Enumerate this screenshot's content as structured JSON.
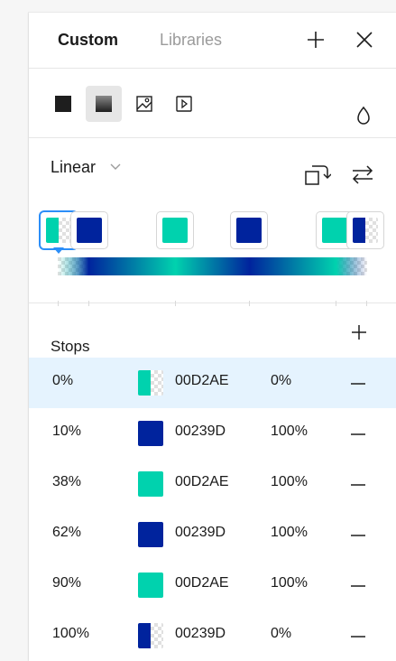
{
  "tabs": {
    "custom": "Custom",
    "libraries": "Libraries"
  },
  "fill_types": [
    "solid",
    "gradient",
    "image",
    "video"
  ],
  "gradient": {
    "type_label": "Linear"
  },
  "stops_section": {
    "title": "Stops"
  },
  "colors": {
    "teal": "#00D2AE",
    "blue": "#00239D",
    "selection": "#e5f3fe",
    "accent": "#2c8ef8"
  },
  "stops": [
    {
      "position": "0%",
      "hex": "00D2AE",
      "opacity": "0%",
      "color": "#00D2AE",
      "alpha": 0
    },
    {
      "position": "10%",
      "hex": "00239D",
      "opacity": "100%",
      "color": "#00239D",
      "alpha": 1
    },
    {
      "position": "38%",
      "hex": "00D2AE",
      "opacity": "100%",
      "color": "#00D2AE",
      "alpha": 1
    },
    {
      "position": "62%",
      "hex": "00239D",
      "opacity": "100%",
      "color": "#00239D",
      "alpha": 1
    },
    {
      "position": "90%",
      "hex": "00D2AE",
      "opacity": "100%",
      "color": "#00D2AE",
      "alpha": 1
    },
    {
      "position": "100%",
      "hex": "00239D",
      "opacity": "0%",
      "color": "#00239D",
      "alpha": 0
    }
  ]
}
